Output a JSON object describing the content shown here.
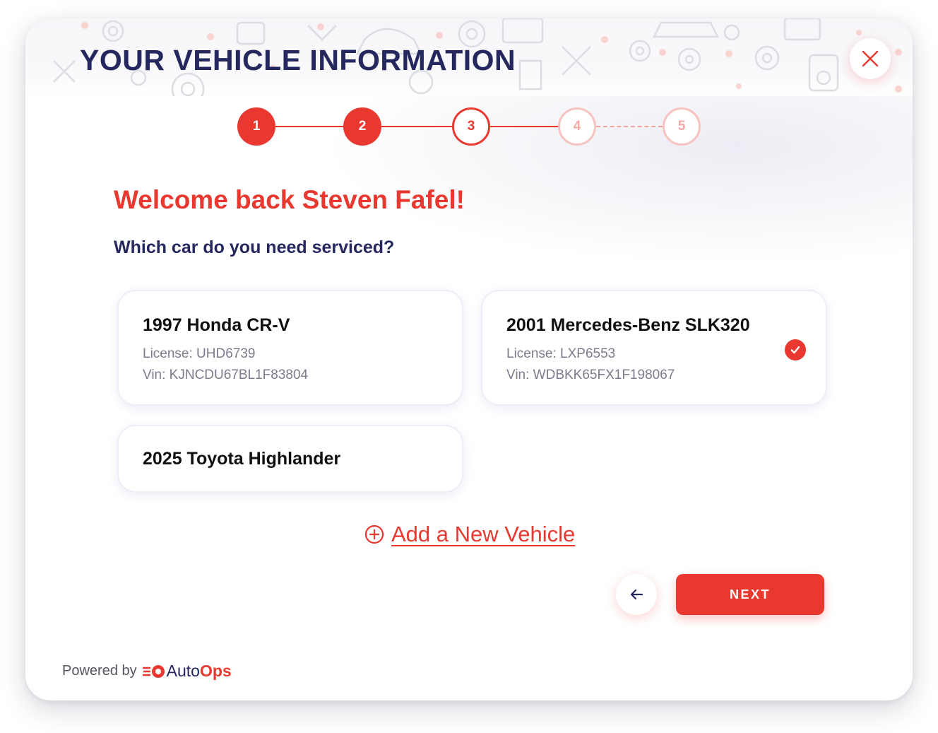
{
  "header": {
    "title": "YOUR VEHICLE INFORMATION",
    "close_icon": "close-icon"
  },
  "stepper": {
    "steps": [
      {
        "label": "1",
        "state": "done"
      },
      {
        "label": "2",
        "state": "done"
      },
      {
        "label": "3",
        "state": "current"
      },
      {
        "label": "4",
        "state": "future"
      },
      {
        "label": "5",
        "state": "future"
      }
    ]
  },
  "main": {
    "welcome": "Welcome back Steven Fafel!",
    "question": "Which car do you need serviced?",
    "vehicles": [
      {
        "name": "1997 Honda CR-V",
        "license": "License: UHD6739",
        "vin": "Vin: KJNCDU67BL1F83804",
        "selected": false
      },
      {
        "name": "2001 Mercedes-Benz SLK320",
        "license": "License: LXP6553",
        "vin": "Vin: WDBKK65FX1F198067",
        "selected": true
      },
      {
        "name": "2025 Toyota Highlander",
        "selected": false
      }
    ],
    "add_vehicle_label": "Add a New Vehicle"
  },
  "actions": {
    "back_icon": "arrow-left-icon",
    "next_label": "NEXT"
  },
  "footer": {
    "powered_by": "Powered by",
    "brand_auto": "Auto",
    "brand_ops": "Ops"
  },
  "colors": {
    "accent": "#e8382f",
    "navy": "#24285e",
    "muted": "#7b7b8c"
  }
}
